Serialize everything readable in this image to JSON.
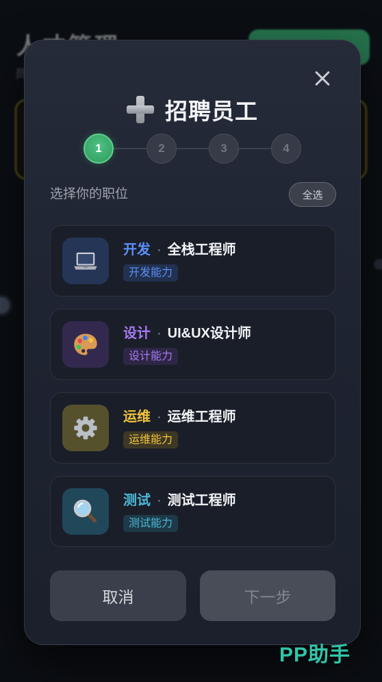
{
  "background": {
    "page_title": "人才管理",
    "page_subtitle": "员"
  },
  "modal": {
    "title": "招聘员工",
    "title_icon": "plus-icon",
    "close_icon": "close-icon",
    "current_step": 1,
    "steps": [
      "1",
      "2",
      "3",
      "4"
    ],
    "section_label": "选择你的职位",
    "select_all_label": "全选",
    "roles": [
      {
        "category": "开发",
        "separator": "·",
        "title": "全栈工程师",
        "tag": "开发能力",
        "icon": "laptop-icon",
        "accent": "#5b8ff9",
        "icon_bg": "#253556",
        "tag_bg": "#22314f"
      },
      {
        "category": "设计",
        "separator": "·",
        "title": "UI&UX设计师",
        "tag": "设计能力",
        "icon": "palette-icon",
        "accent": "#a77bf3",
        "icon_bg": "#33294e",
        "tag_bg": "#2d2645"
      },
      {
        "category": "运维",
        "separator": "·",
        "title": "运维工程师",
        "tag": "运维能力",
        "icon": "gear-icon",
        "accent": "#f2c43d",
        "icon_bg": "#55512c",
        "tag_bg": "#3d3825"
      },
      {
        "category": "测试",
        "separator": "·",
        "title": "测试工程师",
        "tag": "测试能力",
        "icon": "magnifier-icon",
        "accent": "#4cb8d6",
        "icon_bg": "#21475a",
        "tag_bg": "#1e3a47"
      }
    ],
    "cancel_label": "取消",
    "next_label": "下一步",
    "next_enabled": false,
    "colors": {
      "active_step": "#2f9a5d"
    }
  },
  "watermark": "PP助手"
}
